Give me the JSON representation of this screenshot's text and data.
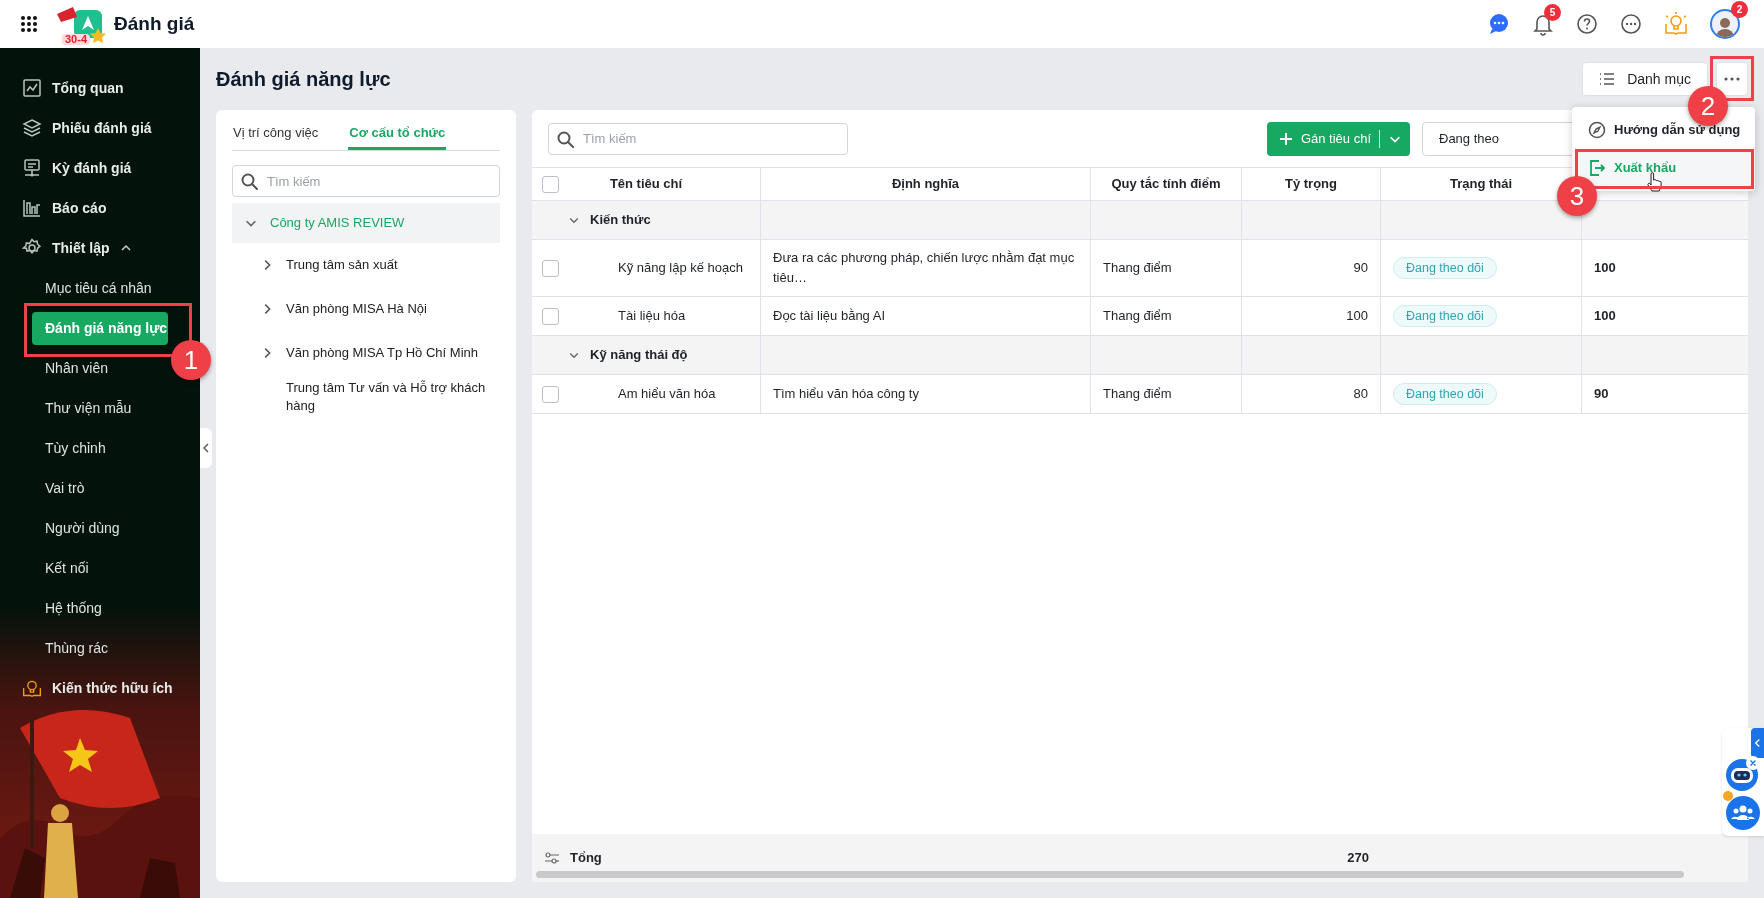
{
  "app": {
    "title": "Đánh giá",
    "logo_badge": "30-4"
  },
  "top_bar": {
    "notification_count": "5",
    "avatar_count": "2"
  },
  "sidebar": {
    "items": [
      {
        "label": "Tổng quan",
        "selected": false
      },
      {
        "label": "Phiếu đánh giá",
        "selected": false
      },
      {
        "label": "Kỳ đánh giá",
        "selected": false
      },
      {
        "label": "Báo cáo",
        "selected": false
      },
      {
        "label": "Thiết lập",
        "selected": false,
        "expanded": true,
        "children": [
          {
            "label": "Mục tiêu cá nhân",
            "selected": false
          },
          {
            "label": "Đánh giá năng lực",
            "selected": true
          },
          {
            "label": "Nhân viên",
            "selected": false
          },
          {
            "label": "Thư viện mẫu",
            "selected": false
          },
          {
            "label": "Tùy chỉnh",
            "selected": false
          },
          {
            "label": "Vai trò",
            "selected": false
          },
          {
            "label": "Người dùng",
            "selected": false
          },
          {
            "label": "Kết nối",
            "selected": false
          },
          {
            "label": "Hệ thống",
            "selected": false
          },
          {
            "label": "Thùng rác",
            "selected": false
          }
        ]
      }
    ],
    "footer_link": "Kiến thức hữu ích"
  },
  "page": {
    "title": "Đánh giá năng lực",
    "catalog_button": "Danh mục"
  },
  "more_menu": {
    "items": [
      {
        "label": "Hướng dẫn sử dụng",
        "highlighted": false
      },
      {
        "label": "Xuất khẩu",
        "highlighted": true
      }
    ]
  },
  "left_panel": {
    "tabs": [
      {
        "label": "Vị trí công việc",
        "selected": false
      },
      {
        "label": "Cơ cấu tổ chức",
        "selected": true
      }
    ],
    "search": {
      "placeholder": "Tìm kiếm"
    },
    "tree": [
      {
        "label": "Công ty AMIS REVIEW",
        "expanded": true,
        "selected": true,
        "children": [
          {
            "label": "Trung tâm sản xuất",
            "expandable": true
          },
          {
            "label": "Văn phòng MISA Hà Nội",
            "expandable": true
          },
          {
            "label": "Văn phòng MISA Tp Hồ Chí Minh",
            "expandable": true
          },
          {
            "label": "Trung tâm Tư vấn và Hỗ trợ khách hàng",
            "expandable": false
          }
        ]
      }
    ]
  },
  "table": {
    "select_all_checked": false,
    "search": {
      "placeholder": "Tìm kiếm"
    },
    "assign_button": "Gán tiêu chí",
    "filter_button": "Đang theo",
    "columns": [
      "Tên tiêu chí",
      "Định nghĩa",
      "Quy tắc tính điểm",
      "Tỷ trọng",
      "Trạng thái"
    ],
    "groups": [
      {
        "name": "Kiến thức",
        "expanded": true,
        "rows": [
          {
            "name": "Kỹ năng lập kế hoạch",
            "definition": "Đưa ra các phương pháp, chiến lược nhằm đạt mục tiêu…",
            "rule": "Thang điểm",
            "weight": "90",
            "status": "Đang theo dõi",
            "column_6": "100",
            "checked": false
          },
          {
            "name": "Tài liệu hóa",
            "definition": "Đọc tài liệu bằng AI",
            "rule": "Thang điểm",
            "weight": "100",
            "status": "Đang theo dõi",
            "column_6": "100",
            "checked": false
          }
        ]
      },
      {
        "name": "Kỹ năng thái độ",
        "expanded": true,
        "rows": [
          {
            "name": "Am hiểu văn hóa",
            "definition": "Tìm hiểu văn hóa công ty",
            "rule": "Thang điểm",
            "weight": "80",
            "status": "Đang theo dõi",
            "column_6": "90",
            "checked": false
          }
        ]
      }
    ],
    "footer": {
      "label": "Tổng",
      "weight_total": "270"
    }
  },
  "annotations": [
    {
      "number": "1"
    },
    {
      "number": "2"
    },
    {
      "number": "3"
    }
  ]
}
